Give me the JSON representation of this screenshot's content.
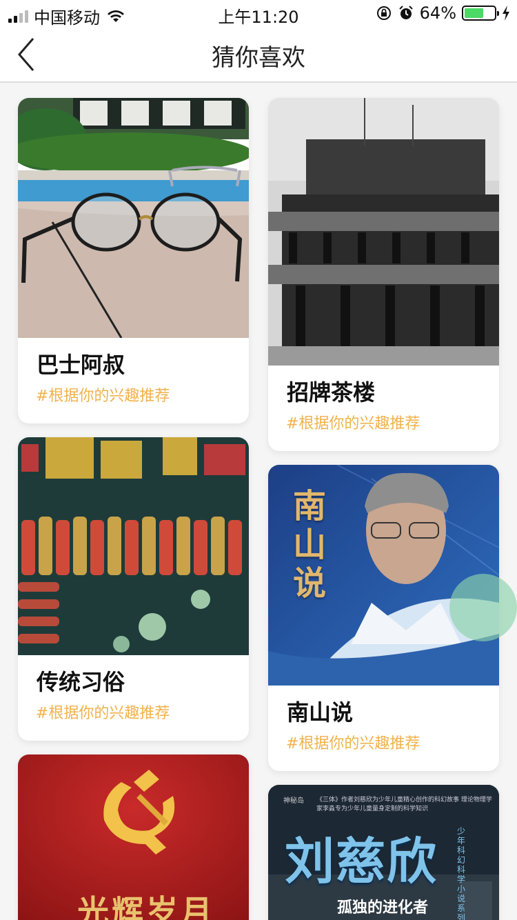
{
  "status_bar": {
    "carrier": "中国移动",
    "time": "上午11:20",
    "battery_percent": "64%",
    "battery_level": 0.64
  },
  "nav": {
    "title": "猜你喜欢"
  },
  "cards": [
    {
      "title": "巴士阿叔",
      "tag": "#根据你的兴趣推荐"
    },
    {
      "title": "招牌茶楼",
      "tag": "#根据你的兴趣推荐"
    },
    {
      "title": "传统习俗",
      "tag": "#根据你的兴趣推荐"
    },
    {
      "title": "南山说",
      "tag": "#根据你的兴趣推荐",
      "cover_text": "南山说"
    },
    {
      "cover_text": "光辉岁月"
    },
    {
      "cover_text": "刘慈欣",
      "cover_subtitle": "孤独的进化者",
      "cover_series": "少年科幻科学小说系列",
      "cover_top": "《三体》作者刘慈欣为少年儿童精心创作的科幻故事 理论物理学家李淼专为少年儿童量身定制的科学知识",
      "cover_publisher": "神秘岛"
    }
  ],
  "colors": {
    "tag": "#f0b24a",
    "battery": "#4cd964"
  }
}
